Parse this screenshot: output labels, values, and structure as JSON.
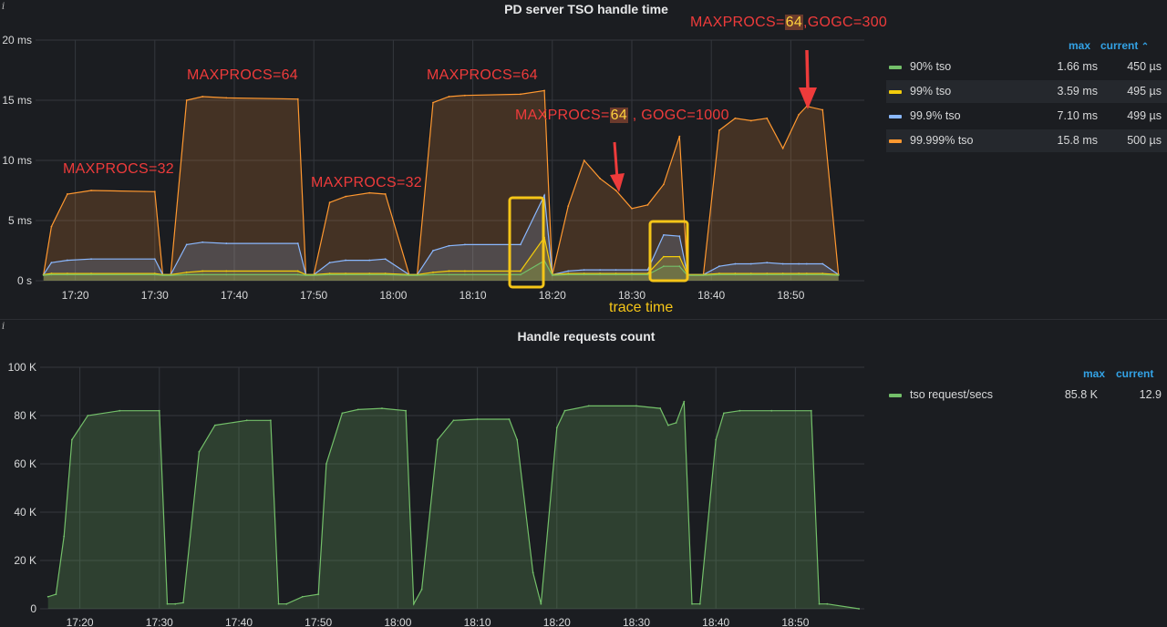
{
  "panel1": {
    "title": "PD server TSO handle time",
    "y_ticks": [
      "20 ms",
      "15 ms",
      "10 ms",
      "5 ms",
      "0 s"
    ],
    "x_ticks": [
      "17:20",
      "17:30",
      "17:40",
      "17:50",
      "18:00",
      "18:10",
      "18:20",
      "18:30",
      "18:40",
      "18:50"
    ],
    "legend_head": {
      "max": "max",
      "current": "current"
    },
    "legend": [
      {
        "name": "90% tso",
        "max": "1.66 ms",
        "current": "450 µs",
        "color": "#73bf69"
      },
      {
        "name": "99% tso",
        "max": "3.59 ms",
        "current": "495 µs",
        "color": "#f2cc0c"
      },
      {
        "name": "99.9% tso",
        "max": "7.10 ms",
        "current": "499 µs",
        "color": "#8ab8ff"
      },
      {
        "name": "99.999% tso",
        "max": "15.8 ms",
        "current": "500 µs",
        "color": "#ff9830"
      }
    ],
    "annotations": {
      "a1": "MAXPROCS=32",
      "a2": "MAXPROCS=64",
      "a3": "MAXPROCS=32",
      "a4": "MAXPROCS=64",
      "a5_pre": "MAXPROCS=",
      "a5_hl": "64",
      "a5_post": " , GOGC=1000",
      "a6_pre": "MAXPROCS=",
      "a6_hl": "64",
      "a6_post": ",GOGC=300",
      "trace": "trace time"
    }
  },
  "panel2": {
    "title": "Handle requests count",
    "y_ticks": [
      "100 K",
      "80 K",
      "60 K",
      "40 K",
      "20 K",
      "0"
    ],
    "x_ticks": [
      "17:20",
      "17:30",
      "17:40",
      "17:50",
      "18:00",
      "18:10",
      "18:20",
      "18:30",
      "18:40",
      "18:50"
    ],
    "legend_head": {
      "max": "max",
      "current": "current"
    },
    "legend": [
      {
        "name": "tso request/secs",
        "max": "85.8 K",
        "current": "12.9",
        "color": "#73bf69"
      }
    ]
  },
  "chart_data": [
    {
      "type": "area",
      "title": "PD server TSO handle time",
      "ylabel": "ms",
      "ylim": [
        0,
        20
      ],
      "x": [
        "17:16",
        "17:17",
        "17:19",
        "17:22",
        "17:30",
        "17:31",
        "17:32",
        "17:34",
        "17:36",
        "17:39",
        "17:48",
        "17:49",
        "17:50",
        "17:52",
        "17:54",
        "17:57",
        "17:59",
        "18:02",
        "18:03",
        "18:05",
        "18:07",
        "18:09",
        "18:16",
        "18:19",
        "18:20",
        "18:22",
        "18:24",
        "18:26",
        "18:28",
        "18:30",
        "18:32",
        "18:34",
        "18:36",
        "18:37",
        "18:39",
        "18:41",
        "18:43",
        "18:45",
        "18:47",
        "18:49",
        "18:51",
        "18:52",
        "18:54",
        "18:56"
      ],
      "series": [
        {
          "name": "99.999% tso",
          "values": [
            0.5,
            4.5,
            7.2,
            7.5,
            7.4,
            0.5,
            0.5,
            15.0,
            15.3,
            15.2,
            15.1,
            0.5,
            0.5,
            6.5,
            7.0,
            7.3,
            7.2,
            0.5,
            0.5,
            14.8,
            15.3,
            15.4,
            15.5,
            15.8,
            0.5,
            6.2,
            10.0,
            8.5,
            7.5,
            6.0,
            6.3,
            8.0,
            12.0,
            0.5,
            0.5,
            12.5,
            13.5,
            13.3,
            13.5,
            11.0,
            13.8,
            14.5,
            14.2,
            0.5
          ]
        },
        {
          "name": "99.9% tso",
          "values": [
            0.5,
            1.5,
            1.7,
            1.8,
            1.8,
            0.5,
            0.5,
            3.0,
            3.2,
            3.1,
            3.1,
            0.5,
            0.5,
            1.5,
            1.7,
            1.7,
            1.8,
            0.5,
            0.5,
            2.5,
            2.9,
            3.0,
            3.0,
            7.1,
            0.5,
            0.8,
            0.9,
            0.9,
            0.9,
            0.9,
            0.9,
            3.8,
            3.7,
            0.5,
            0.5,
            1.2,
            1.4,
            1.4,
            1.5,
            1.4,
            1.4,
            1.4,
            1.4,
            0.5
          ]
        },
        {
          "name": "99% tso",
          "values": [
            0.5,
            0.6,
            0.6,
            0.6,
            0.6,
            0.5,
            0.5,
            0.7,
            0.8,
            0.8,
            0.8,
            0.5,
            0.5,
            0.6,
            0.6,
            0.6,
            0.6,
            0.5,
            0.5,
            0.7,
            0.8,
            0.8,
            0.8,
            3.6,
            0.5,
            0.6,
            0.6,
            0.6,
            0.6,
            0.6,
            0.6,
            2.0,
            2.0,
            0.5,
            0.5,
            0.6,
            0.6,
            0.6,
            0.6,
            0.6,
            0.6,
            0.6,
            0.6,
            0.5
          ]
        },
        {
          "name": "90% tso",
          "values": [
            0.45,
            0.5,
            0.5,
            0.5,
            0.5,
            0.45,
            0.45,
            0.5,
            0.5,
            0.5,
            0.5,
            0.45,
            0.45,
            0.5,
            0.5,
            0.5,
            0.5,
            0.45,
            0.45,
            0.5,
            0.5,
            0.5,
            0.5,
            1.66,
            0.45,
            0.5,
            0.5,
            0.5,
            0.5,
            0.5,
            0.5,
            1.2,
            1.2,
            0.45,
            0.45,
            0.5,
            0.5,
            0.5,
            0.5,
            0.5,
            0.5,
            0.5,
            0.5,
            0.45
          ]
        }
      ]
    },
    {
      "type": "area",
      "title": "Handle requests count",
      "ylim": [
        0,
        100000
      ],
      "x": [
        "17:16",
        "17:17",
        "17:18",
        "17:19",
        "17:21",
        "17:25",
        "17:30",
        "17:31",
        "17:32",
        "17:33",
        "17:35",
        "17:37",
        "17:41",
        "17:44",
        "17:45",
        "17:46",
        "17:48",
        "17:50",
        "17:51",
        "17:53",
        "17:55",
        "17:58",
        "18:01",
        "18:02",
        "18:03",
        "18:05",
        "18:07",
        "18:10",
        "18:14",
        "18:15",
        "18:17",
        "18:18",
        "18:20",
        "18:21",
        "18:24",
        "18:30",
        "18:33",
        "18:34",
        "18:35",
        "18:36",
        "18:37",
        "18:38",
        "18:40",
        "18:41",
        "18:43",
        "18:47",
        "18:52",
        "18:53",
        "18:54",
        "18:58"
      ],
      "series": [
        {
          "name": "tso request/secs",
          "values": [
            5000,
            6000,
            30000,
            70000,
            80000,
            82000,
            82000,
            2000,
            2000,
            2500,
            65000,
            76000,
            78000,
            78000,
            2000,
            2000,
            5000,
            6000,
            60000,
            81000,
            82500,
            83000,
            82000,
            2000,
            8000,
            70000,
            78000,
            78500,
            78500,
            70000,
            15000,
            2000,
            75000,
            82000,
            84000,
            84000,
            83000,
            76000,
            77000,
            85800,
            2000,
            2000,
            70000,
            81000,
            82000,
            82000,
            82000,
            2000,
            2000,
            0
          ]
        }
      ]
    }
  ]
}
